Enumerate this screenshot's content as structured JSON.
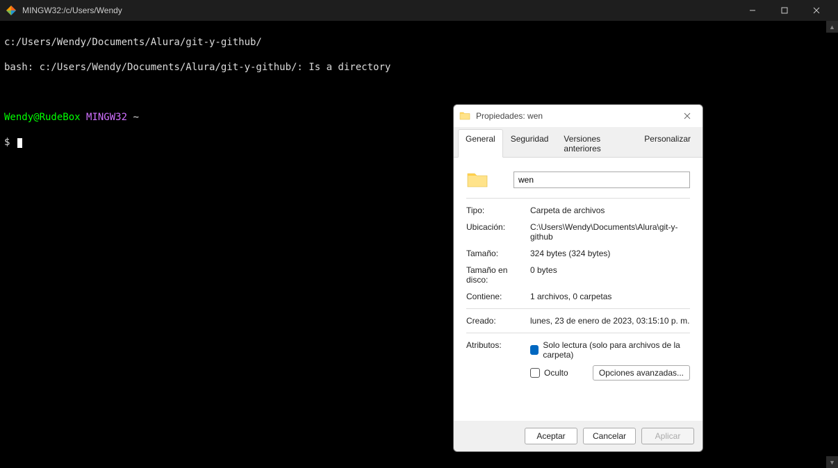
{
  "window": {
    "title": "MINGW32:/c/Users/Wendy"
  },
  "terminal": {
    "line1": "c:/Users/Wendy/Documents/Alura/git-y-github/",
    "line2": "bash: c:/Users/Wendy/Documents/Alura/git-y-github/: Is a directory",
    "prompt_user": "Wendy@RudeBox",
    "prompt_env": "MINGW32",
    "prompt_tilde": "~",
    "prompt_symbol": "$"
  },
  "dialog": {
    "title": "Propiedades: wen",
    "tabs": {
      "general": "General",
      "security": "Seguridad",
      "previous": "Versiones anteriores",
      "customize": "Personalizar"
    },
    "name_value": "wen",
    "rows": {
      "type_label": "Tipo:",
      "type_value": "Carpeta de archivos",
      "location_label": "Ubicación:",
      "location_value": "C:\\Users\\Wendy\\Documents\\Alura\\git-y-github",
      "size_label": "Tamaño:",
      "size_value": "324 bytes (324 bytes)",
      "sizedisk_label": "Tamaño en disco:",
      "sizedisk_value": "0 bytes",
      "contains_label": "Contiene:",
      "contains_value": "1 archivos, 0 carpetas",
      "created_label": "Creado:",
      "created_value": "lunes, 23 de enero de 2023, 03:15:10 p. m.",
      "attrs_label": "Atributos:",
      "readonly_label": "Solo lectura (solo para archivos de la carpeta)",
      "hidden_label": "Oculto",
      "advanced_btn": "Opciones avanzadas..."
    },
    "buttons": {
      "ok": "Aceptar",
      "cancel": "Cancelar",
      "apply": "Aplicar"
    }
  }
}
